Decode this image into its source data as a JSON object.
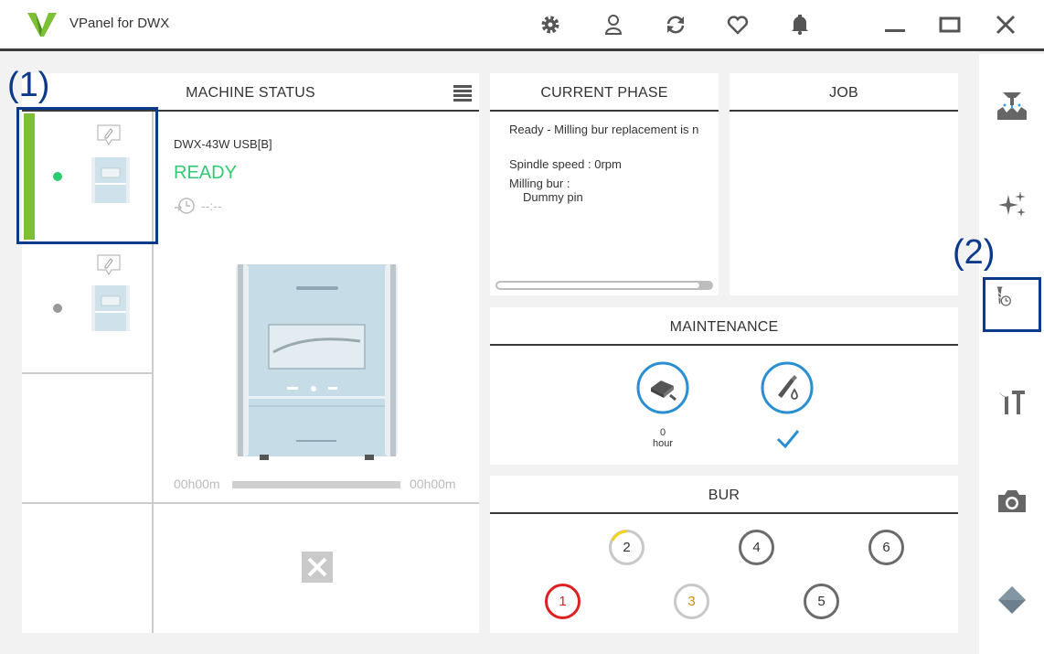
{
  "app": {
    "title": "VPanel for DWX"
  },
  "annotations": {
    "a1": "(1)",
    "a2": "(2)"
  },
  "machine_status": {
    "title": "MACHINE STATUS",
    "machines": [
      {
        "name": "DWX-43W USB[B]",
        "status": "READY",
        "time": "--:--",
        "status_color": "#2ecc71"
      },
      {
        "name": "",
        "status": "",
        "time": "",
        "status_color": "#999999"
      }
    ],
    "progress_start": "00h00m",
    "progress_end": "00h00m",
    "progress_fraction": 0
  },
  "current_phase": {
    "title": "CURRENT PHASE",
    "message": "Ready - Milling bur replacement is n",
    "spindle": "Spindle speed : 0rpm",
    "bur_label": "Milling bur :",
    "bur_value": "Dummy pin",
    "progress_fraction": 0.96
  },
  "job": {
    "title": "JOB"
  },
  "maintenance": {
    "title": "MAINTENANCE",
    "hours_value": "0",
    "hours_unit": "hour"
  },
  "bur": {
    "title": "BUR",
    "slots": [
      {
        "num": "1",
        "color": "#e02020",
        "text_color": "#e02020"
      },
      {
        "num": "2",
        "color": "#c8c8c8",
        "text_color": "#333333"
      },
      {
        "num": "3",
        "color": "#c8c8c8",
        "text_color": "#e08a00"
      },
      {
        "num": "4",
        "color": "#6b6b6b",
        "text_color": "#333333"
      },
      {
        "num": "5",
        "color": "#6b6b6b",
        "text_color": "#333333"
      },
      {
        "num": "6",
        "color": "#6b6b6b",
        "text_color": "#333333"
      }
    ]
  },
  "colors": {
    "accent_green": "#7dc035",
    "ready_green": "#2ecc71",
    "annot_blue": "#0b3a8a",
    "maint_blue": "#2a8fd0"
  }
}
